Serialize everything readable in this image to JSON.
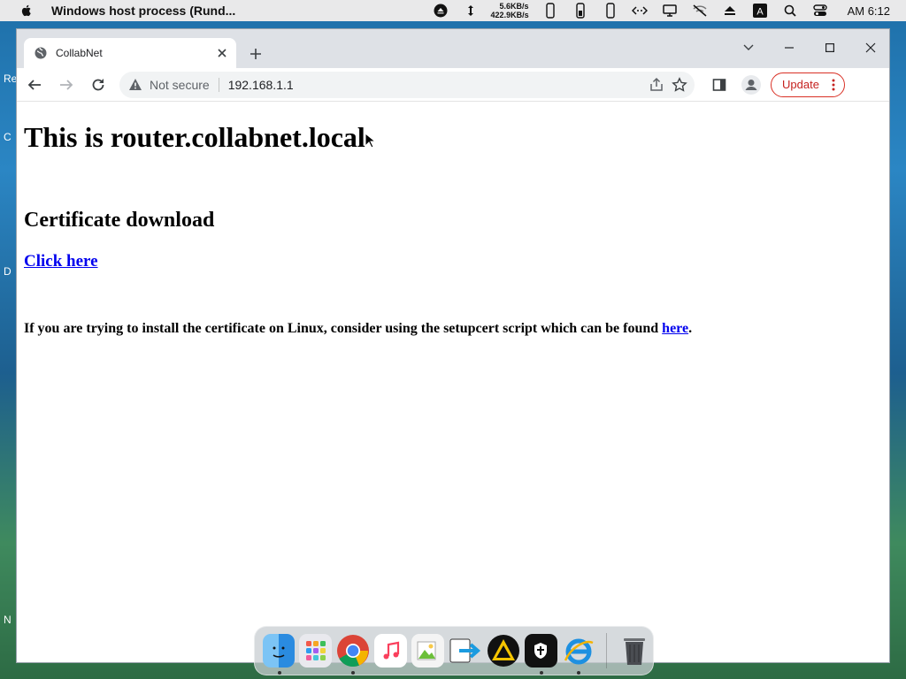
{
  "menubar": {
    "app_title": "Windows host process (Rund...",
    "net_up": "5.6KB/s",
    "net_down": "422.9KB/s",
    "clock": "AM 6:12"
  },
  "desktop": {
    "labels": [
      "Re",
      "C",
      "D",
      "N"
    ]
  },
  "browser": {
    "tab_title": "CollabNet",
    "not_secure_label": "Not secure",
    "url": "192.168.1.1",
    "update_label": "Update"
  },
  "page": {
    "heading": "This is router.collabnet.local",
    "subheading": "Certificate download",
    "link_label": "Click here",
    "note_text": "If you are trying to install the certificate on Linux, consider using the setupcert script which can be found ",
    "note_link": "here",
    "note_end": "."
  },
  "dock": {
    "apps": [
      "finder-icon",
      "launchpad-icon",
      "chrome-icon",
      "music-icon",
      "preview-icon",
      "migration-icon",
      "vlc-like-icon",
      "shield-app-icon",
      "ie-icon",
      "trash-icon"
    ]
  },
  "colors": {
    "link": "#0000ee",
    "update_red": "#c5221f",
    "tab_strip": "#dee1e6"
  }
}
